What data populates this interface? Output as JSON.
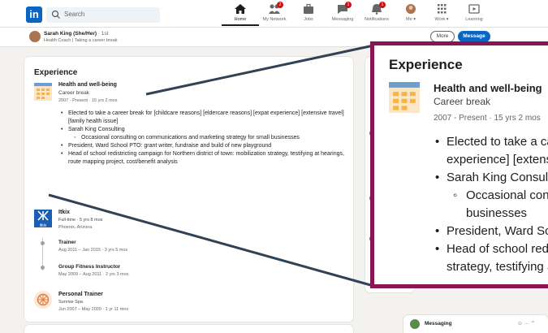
{
  "nav": {
    "logo": "in",
    "search_placeholder": "Search",
    "items": [
      {
        "label": "Home",
        "icon": "home-icon",
        "active": true
      },
      {
        "label": "My Network",
        "icon": "network-icon",
        "badge": "2"
      },
      {
        "label": "Jobs",
        "icon": "jobs-icon"
      },
      {
        "label": "Messaging",
        "icon": "messaging-icon",
        "badge": "1"
      },
      {
        "label": "Notifications",
        "icon": "bell-icon",
        "badge": "1"
      },
      {
        "label": "Me ▾",
        "icon": "avatar-icon"
      },
      {
        "label": "Work ▾",
        "icon": "grid-icon"
      },
      {
        "label": "Learning",
        "icon": "learning-icon"
      }
    ]
  },
  "profile_bar": {
    "name": "Sarah King (She/Her)",
    "degree": " · 1st",
    "headline": "Health Coach | Taking a career break",
    "more_label": "More",
    "message_label": "Message"
  },
  "experience": {
    "title": "Experience",
    "entries": [
      {
        "title": "Health and well-being",
        "subtitle": "Career break",
        "date": "2007 - Present · 15 yrs 2 mos",
        "bullets": [
          "Elected to take a career break for [childcare reasons] [eldercare reasons] [expat",
          "experience] [extensive travel] [family health issue]",
          "Sarah King Consulting",
          "Occasional consulting on communications and marketing strategy for small",
          "businesses",
          "President, Ward School PTO: grant writer, fundraise and build of new playground",
          "Head of school redistricting campaign for Northern district of town: mobilization",
          "strategy, testifying at hearings, route mapping project, cost/benefit analysis"
        ]
      },
      {
        "company": "Itkix",
        "logo_text": "itkix",
        "subtitle": "Full-time · 5 yrs 8 mos",
        "location": "Phoenix, Arizona",
        "roles": [
          {
            "title": "Trainer",
            "date": "Aug 2011 – Jan 2015 · 3 yrs 5 mos"
          },
          {
            "title": "Group Fitness Instructor",
            "date": "May 2009 – Aug 2011 · 2 yrs 3 mos"
          }
        ]
      },
      {
        "title": "Personal Trainer",
        "subtitle": "Sunrise Spa",
        "date": "Jun 2007 – May 2009 · 1 yr 11 mos"
      }
    ]
  },
  "zoom": {
    "title": "Experience",
    "job_title": "Health and well-being",
    "job_subtitle": "Career break",
    "job_date": "2007 - Present · 15 yrs 2 mos",
    "lines": [
      "Elected to take a career break for [childcare reasons] [eldercare reasons] [expat",
      "experience] [extensive travel] [family health issue]",
      "Sarah King Consulting",
      "Occasional consulting on communications and marketing strategy for small",
      "businesses",
      "President, Ward School PTO: grant writer, fundraise and build of new playground",
      "Head of school redistricting campaign for Northern district of town: mobilization",
      "strategy, testifying at hearings, route mapping project, cost/benefit analysis"
    ],
    "frame_color": "#8a1553"
  },
  "messaging": {
    "label": "Messaging",
    "icons": "☺ ··· ⌃"
  },
  "colors": {
    "brand": "#0a66c2",
    "badge": "#cc1016",
    "pointer": "#2f4256"
  }
}
